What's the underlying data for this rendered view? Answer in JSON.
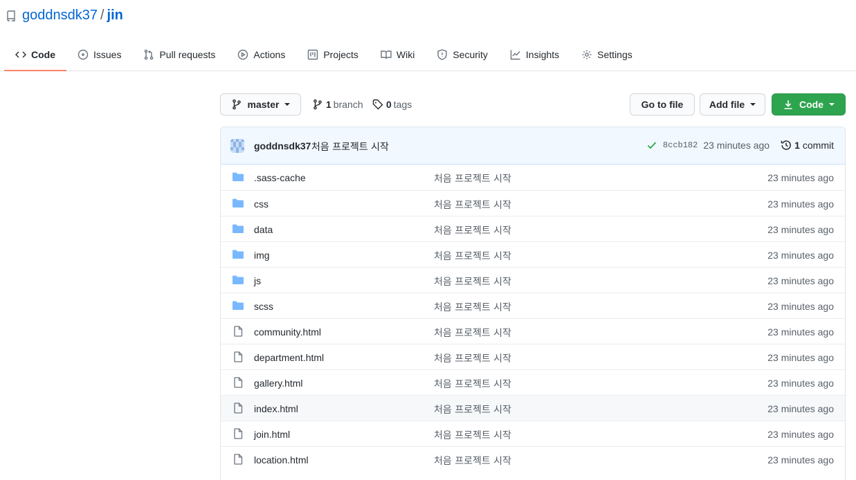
{
  "repo": {
    "owner": "goddnsdk37",
    "separator": "/",
    "name": "jin"
  },
  "tabs": [
    {
      "label": "Code",
      "icon": "code-icon",
      "selected": true
    },
    {
      "label": "Issues",
      "icon": "issue-icon"
    },
    {
      "label": "Pull requests",
      "icon": "pull-request-icon"
    },
    {
      "label": "Actions",
      "icon": "play-icon"
    },
    {
      "label": "Projects",
      "icon": "project-icon"
    },
    {
      "label": "Wiki",
      "icon": "book-icon"
    },
    {
      "label": "Security",
      "icon": "shield-icon"
    },
    {
      "label": "Insights",
      "icon": "graph-icon"
    },
    {
      "label": "Settings",
      "icon": "gear-icon"
    }
  ],
  "toolbar": {
    "branch": "master",
    "branch_count": "1",
    "branch_word": "branch",
    "tag_count": "0",
    "tag_word": "tags",
    "goto_file": "Go to file",
    "add_file": "Add file",
    "code": "Code"
  },
  "commit": {
    "author": "goddnsdk37",
    "message": "처음 프로젝트 시작",
    "sha": "8ccb182",
    "time": "23 minutes ago",
    "count": "1",
    "count_word": "commit"
  },
  "files": [
    {
      "type": "dir",
      "name": ".sass-cache",
      "message": "처음 프로젝트 시작",
      "time": "23 minutes ago"
    },
    {
      "type": "dir",
      "name": "css",
      "message": "처음 프로젝트 시작",
      "time": "23 minutes ago"
    },
    {
      "type": "dir",
      "name": "data",
      "message": "처음 프로젝트 시작",
      "time": "23 minutes ago"
    },
    {
      "type": "dir",
      "name": "img",
      "message": "처음 프로젝트 시작",
      "time": "23 minutes ago"
    },
    {
      "type": "dir",
      "name": "js",
      "message": "처음 프로젝트 시작",
      "time": "23 minutes ago"
    },
    {
      "type": "dir",
      "name": "scss",
      "message": "처음 프로젝트 시작",
      "time": "23 minutes ago"
    },
    {
      "type": "file",
      "name": "community.html",
      "message": "처음 프로젝트 시작",
      "time": "23 minutes ago"
    },
    {
      "type": "file",
      "name": "department.html",
      "message": "처음 프로젝트 시작",
      "time": "23 minutes ago"
    },
    {
      "type": "file",
      "name": "gallery.html",
      "message": "처음 프로젝트 시작",
      "time": "23 minutes ago"
    },
    {
      "type": "file",
      "name": "index.html",
      "message": "처음 프로젝트 시작",
      "time": "23 minutes ago",
      "highlight": true
    },
    {
      "type": "file",
      "name": "join.html",
      "message": "처음 프로젝트 시작",
      "time": "23 minutes ago"
    },
    {
      "type": "file",
      "name": "location.html",
      "message": "처음 프로젝트 시작",
      "time": "23 minutes ago"
    }
  ],
  "colors": {
    "link": "#0366d6",
    "folder": "#79b8ff",
    "primary_button": "#2ea44f",
    "selected_tab": "#f9826c",
    "commit_bar": "#f1f8ff"
  }
}
